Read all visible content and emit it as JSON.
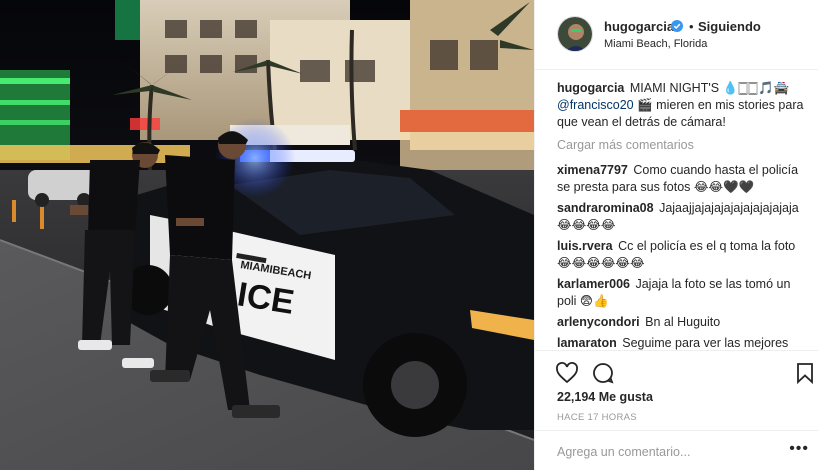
{
  "post": {
    "author": {
      "username": "hugogarcia",
      "verified": true,
      "follow_status": "Siguiendo",
      "separator": "•",
      "location": "Miami Beach, Florida"
    },
    "caption": {
      "username": "hugogarcia",
      "text_1": "MIAMI NIGHT'S",
      "emoji_1": "💧🀆🀆🎵🚔",
      "mention": "@francisco20",
      "emoji_2": "🎬",
      "text_2": "mieren en mis stories para que vean el detrás de cámara!"
    },
    "load_more_label": "Cargar más comentarios",
    "comments": [
      {
        "username": "ximena7797",
        "text": "Como cuando hasta el policía se presta para sus fotos 😂😂🖤🖤"
      },
      {
        "username": "sandraromina08",
        "text": "Jajaajjajajajajajajajajajaja 😂😂😂😂"
      },
      {
        "username": "luis.rvera",
        "text": "Cc el policía es el q toma la foto 😂😂😂😂😂😂"
      },
      {
        "username": "karlamer006",
        "text": "Jajaja la foto se las tomó un poli 😨👍"
      },
      {
        "username": "arlenycondori",
        "text": "Bn al Huguito"
      },
      {
        "username": "lamaraton",
        "text": "Seguime para ver las mejores"
      }
    ],
    "likes": {
      "count": "22,194",
      "label": "Me gusta"
    },
    "time_ago": "HACE 17 HORAS",
    "add_comment_placeholder": "Agrega un comentario...",
    "more_options": "•••",
    "icons": {
      "like": "heart-icon",
      "comment": "comment-bubble-icon",
      "save": "bookmark-icon",
      "verified": "verified-badge-icon"
    },
    "colors": {
      "verified_blue": "#3897f0",
      "mention_blue": "#003569",
      "muted_gray": "#999999"
    }
  },
  "photo": {
    "car_door_text": "MIAMIBEACH",
    "car_door_text_2": "ICE"
  }
}
